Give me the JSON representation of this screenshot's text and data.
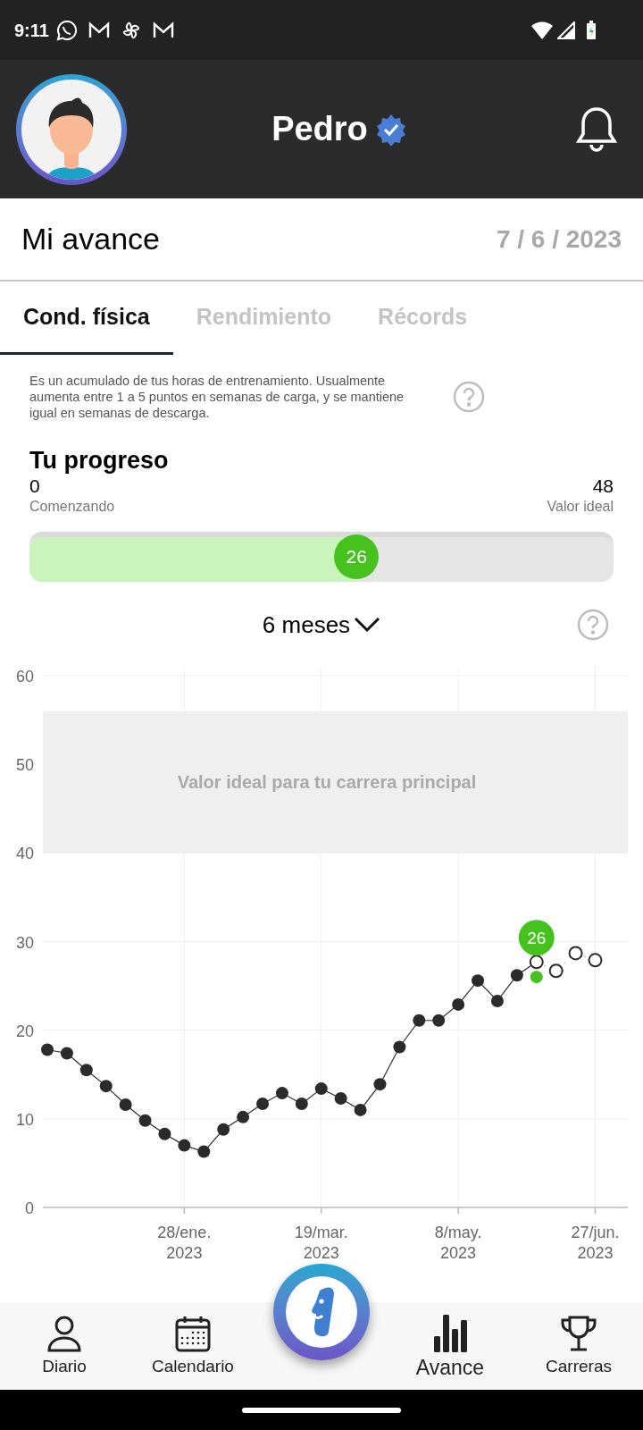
{
  "status_bar": {
    "time": "9:11"
  },
  "header": {
    "user_name": "Pedro",
    "verified": true
  },
  "title_row": {
    "title": "Mi avance",
    "date": "7 / 6 / 2023"
  },
  "tabs": [
    {
      "label": "Cond. física",
      "selected": true
    },
    {
      "label": "Rendimiento",
      "selected": false
    },
    {
      "label": "Récords",
      "selected": false
    }
  ],
  "description": "Es un acumulado de tus horas de entrenamiento. Usualmente aumenta entre 1 a 5 puntos en semanas de carga, y se mantiene igual en semanas de descarga.",
  "progress": {
    "title": "Tu progreso",
    "min_value": "0",
    "min_label": "Comenzando",
    "max_value": "48",
    "max_label": "Valor ideal",
    "level": 0.56,
    "current": "26"
  },
  "period": {
    "label": "6 meses"
  },
  "chart": {
    "chart_data": {
      "type": "line",
      "categories": [
        null,
        null,
        null,
        null,
        null,
        null,
        null,
        "28/ene. 2023",
        null,
        null,
        null,
        null,
        null,
        null,
        "19/mar. 2023",
        null,
        null,
        null,
        null,
        null,
        null,
        "8/may. 2023",
        null,
        null,
        null,
        null,
        null,
        null,
        "27/jun. 2023"
      ],
      "ylim": [
        0,
        60
      ],
      "yticks": [
        0,
        10,
        20,
        30,
        40,
        50,
        60
      ],
      "grid": true,
      "series": [
        {
          "color": "#2b2b2b",
          "marker": "o",
          "values": [
            17.8,
            17.4,
            15.5,
            13.7,
            11.6,
            9.8,
            8.3,
            7.0,
            6.3,
            8.8,
            10.2,
            11.7,
            12.9,
            11.7,
            13.4,
            12.3,
            11.0,
            13.9,
            18.1,
            21.1,
            21.1,
            22.9,
            25.6,
            23.3,
            26.2,
            27.7,
            null,
            null,
            null
          ]
        },
        {
          "color": "#2b2b2b",
          "marker": "o",
          "line_style": "dashed",
          "values": [
            null,
            null,
            null,
            null,
            null,
            null,
            null,
            null,
            null,
            null,
            null,
            null,
            null,
            null,
            null,
            null,
            null,
            null,
            null,
            null,
            null,
            null,
            null,
            null,
            null,
            27.7,
            26.7,
            28.7,
            27.9
          ]
        },
        {
          "color": "#46c21f",
          "marker": "o",
          "values": [
            null,
            null,
            null,
            null,
            null,
            null,
            null,
            null,
            null,
            null,
            null,
            null,
            null,
            null,
            null,
            null,
            null,
            null,
            null,
            null,
            null,
            null,
            null,
            null,
            null,
            26.0,
            null,
            null,
            null
          ],
          "value_labels": [
            null,
            null,
            null,
            null,
            null,
            null,
            null,
            null,
            null,
            null,
            null,
            null,
            null,
            null,
            null,
            null,
            null,
            null,
            null,
            null,
            null,
            null,
            null,
            null,
            null,
            "26",
            null,
            null,
            null
          ]
        }
      ],
      "bands": [
        {
          "axis": "y",
          "from": 40,
          "to": 56,
          "label": "Valor ideal para tu carrera principal"
        }
      ]
    }
  },
  "bottom_nav": [
    {
      "label": "Diario",
      "kind": "person",
      "selected": false
    },
    {
      "label": "Calendario",
      "kind": "calendar",
      "selected": false
    },
    {
      "label": "Avance",
      "kind": "bars",
      "selected": true
    },
    {
      "label": "Carreras",
      "kind": "trophy",
      "selected": false
    }
  ]
}
